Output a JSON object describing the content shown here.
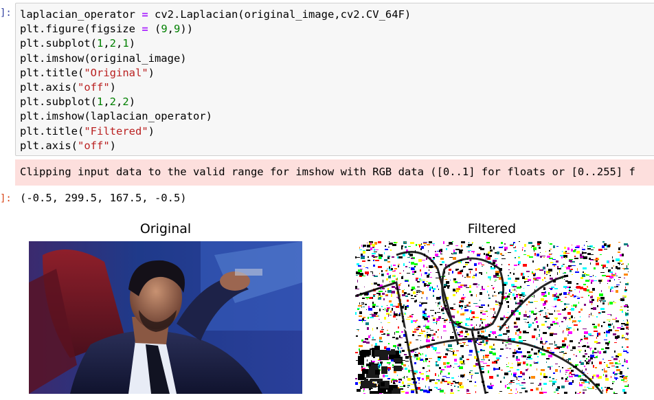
{
  "input_prompt": "]:",
  "output_prompt": "]:",
  "code": {
    "lines": [
      [
        {
          "t": "laplacian_operator "
        },
        {
          "t": "=",
          "k": "op"
        },
        {
          "t": " cv2.Laplacian(original_image,cv2.CV_64F)"
        }
      ],
      [
        {
          "t": "plt.figure(figsize "
        },
        {
          "t": "=",
          "k": "op"
        },
        {
          "t": " ("
        },
        {
          "t": "9",
          "k": "num"
        },
        {
          "t": ","
        },
        {
          "t": "9",
          "k": "num"
        },
        {
          "t": "))"
        }
      ],
      [
        {
          "t": "plt.subplot("
        },
        {
          "t": "1",
          "k": "num"
        },
        {
          "t": ","
        },
        {
          "t": "2",
          "k": "num"
        },
        {
          "t": ","
        },
        {
          "t": "1",
          "k": "num"
        },
        {
          "t": ")"
        }
      ],
      [
        {
          "t": "plt.imshow(original_image)"
        }
      ],
      [
        {
          "t": "plt.title("
        },
        {
          "t": "\"Original\"",
          "k": "str"
        },
        {
          "t": ")"
        }
      ],
      [
        {
          "t": "plt.axis("
        },
        {
          "t": "\"off\"",
          "k": "str"
        },
        {
          "t": ")"
        }
      ],
      [
        {
          "t": "plt.subplot("
        },
        {
          "t": "1",
          "k": "num"
        },
        {
          "t": ","
        },
        {
          "t": "2",
          "k": "num"
        },
        {
          "t": ","
        },
        {
          "t": "2",
          "k": "num"
        },
        {
          "t": ")"
        }
      ],
      [
        {
          "t": "plt.imshow(laplacian_operator)"
        }
      ],
      [
        {
          "t": "plt.title("
        },
        {
          "t": "\"Filtered\"",
          "k": "str"
        },
        {
          "t": ")"
        }
      ],
      [
        {
          "t": "plt.axis("
        },
        {
          "t": "\"off\"",
          "k": "str"
        },
        {
          "t": ")"
        }
      ]
    ]
  },
  "stderr_text": "Clipping input data to the valid range for imshow with RGB data ([0..1] for floats or [0..255] f",
  "execute_result": "(-0.5, 299.5, 167.5, -0.5)",
  "figure": {
    "left_title": "Original",
    "right_title": "Filtered"
  },
  "colors": {
    "prompt_in": "#303f9f",
    "prompt_out": "#d84315",
    "string": "#ba2121",
    "number": "#008000",
    "operator": "#aa22ff",
    "stderr_bg": "#fddfdd",
    "cell_bg": "#f7f7f7"
  }
}
